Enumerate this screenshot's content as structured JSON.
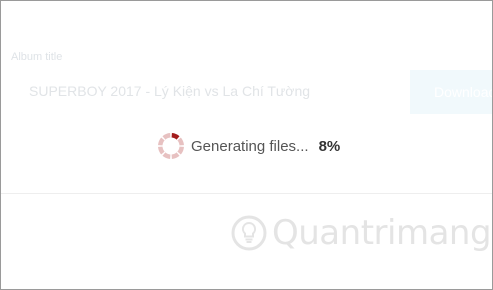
{
  "album": {
    "label": "Album title",
    "value": "SUPERBOY 2017 - Lý Kiện vs La Chí Tường"
  },
  "download_button": {
    "label": "Download"
  },
  "status": {
    "text": "Generating files...",
    "percent_text": "8%",
    "progress": 0.08
  },
  "watermark": {
    "text": "Quantrimang"
  },
  "colors": {
    "spinner_active": "#a31c1c",
    "spinner_inactive": "#e7c1c1",
    "button_bg": "#f1f9fc"
  },
  "icons": {
    "spinner": "loading-spinner-icon",
    "watermark_logo": "lightbulb-logo-icon"
  }
}
